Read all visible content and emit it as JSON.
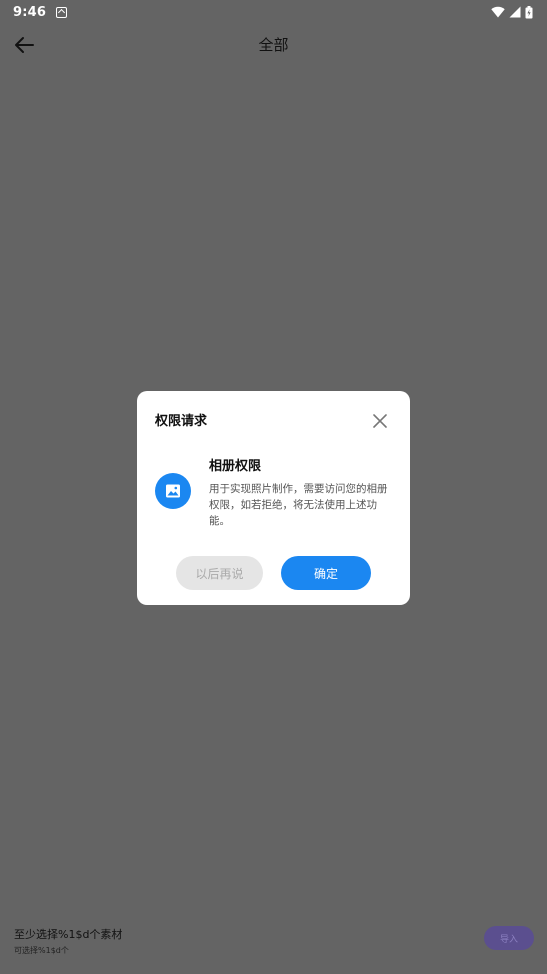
{
  "status_bar": {
    "time": "9:46",
    "icons": [
      "app-notification-icon",
      "wifi-icon",
      "signal-icon",
      "battery-icon"
    ]
  },
  "app_bar": {
    "back_icon": "arrow-left-icon",
    "title": "全部"
  },
  "dialog": {
    "title": "权限请求",
    "close_icon": "close-icon",
    "permission": {
      "icon": "image-icon",
      "name": "相册权限",
      "description": "用于实现照片制作，需要访问您的相册权限，如若拒绝，将无法使用上述功能。"
    },
    "later_label": "以后再说",
    "confirm_label": "确定"
  },
  "bottom_bar": {
    "min_select_text": "至少选择%1$d个素材",
    "max_select_text": "可选择%1$d个",
    "import_label": "导入"
  },
  "colors": {
    "overlay_background": "#646464",
    "accent": "#1b87f1",
    "dialog_background": "#ffffff",
    "secondary_button": "#e5e5e5",
    "import_button": "#5b4f8f"
  }
}
